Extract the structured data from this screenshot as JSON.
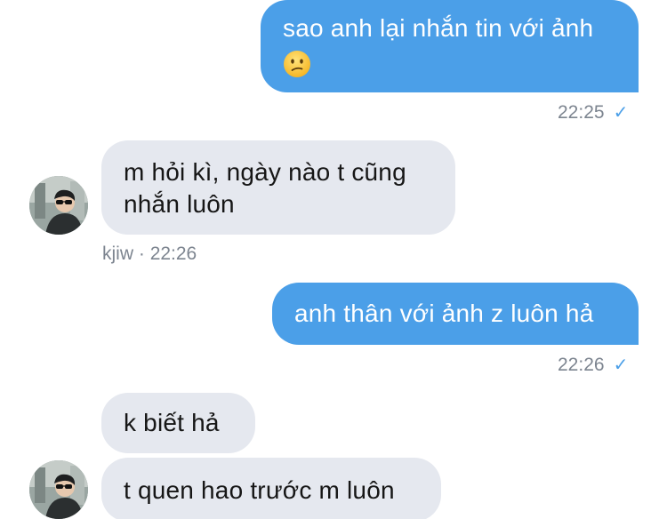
{
  "messages": [
    {
      "direction": "outgoing",
      "text": "sao anh lại nhắn tin với ảnh",
      "emoji": "confused-face",
      "time": "22:25",
      "status_icon": "check-icon"
    },
    {
      "direction": "incoming",
      "text_lines": [
        "m hỏi kì, ngày nào t cũng",
        "nhắn luôn"
      ],
      "sender": "kjiw",
      "separator": "·",
      "time": "22:26"
    },
    {
      "direction": "outgoing",
      "text": "anh thân với ảnh z luôn hả",
      "time": "22:26",
      "status_icon": "check-icon"
    },
    {
      "direction": "incoming",
      "text": "k biết hả"
    },
    {
      "direction": "incoming",
      "text": "t quen hao trước m luôn"
    }
  ],
  "colors": {
    "outgoing_bubble": "#4b9fe8",
    "incoming_bubble": "#e5e8ef",
    "meta_text": "#7d8590",
    "check": "#4b9fe8"
  }
}
